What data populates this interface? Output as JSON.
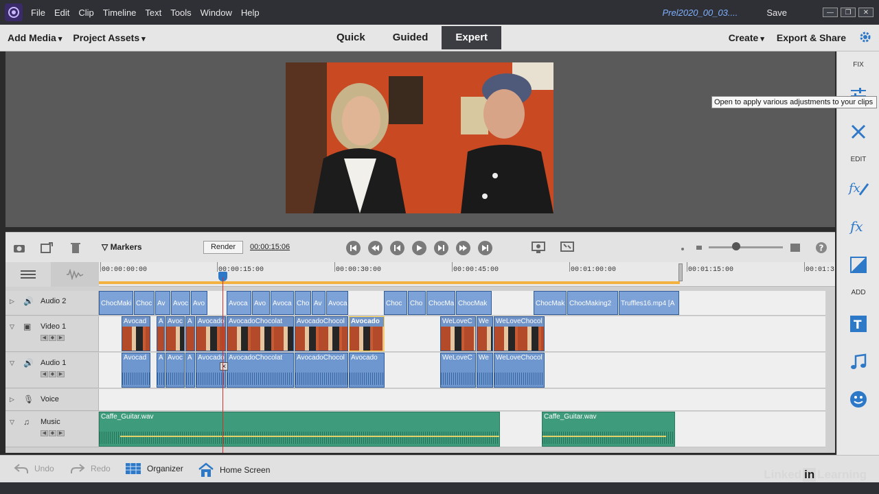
{
  "menu": {
    "items": [
      "File",
      "Edit",
      "Clip",
      "Timeline",
      "Text",
      "Tools",
      "Window",
      "Help"
    ],
    "doc_title": "Prel2020_00_03....",
    "save": "Save"
  },
  "topbar": {
    "add_media": "Add Media",
    "project_assets": "Project Assets",
    "modes": [
      "Quick",
      "Guided",
      "Expert"
    ],
    "active_mode": "Expert",
    "create": "Create",
    "export_share": "Export & Share"
  },
  "right_panel": {
    "fix_label": "FIX",
    "edit_label": "EDIT",
    "add_label": "ADD",
    "tooltip": "Open to apply various adjustments to your clips"
  },
  "timeline_controls": {
    "markers": "Markers",
    "render": "Render",
    "timecode": "00:00:15:06"
  },
  "ruler": {
    "ticks": [
      "00:00:00:00",
      "00:00:15:00",
      "00:00:30:00",
      "00:00:45:00",
      "00:01:00:00",
      "00:01:15:00",
      "00:01:3"
    ]
  },
  "tracks": {
    "audio2": "Audio 2",
    "video1": "Video 1",
    "audio1": "Audio 1",
    "voice": "Voice",
    "music": "Music"
  },
  "clips": {
    "audio2": [
      "ChocMaki",
      "Choc",
      "Av",
      "Avoc",
      "Avo",
      "Avoca",
      "Avo",
      "Avoca",
      "Cho",
      "Av",
      "Avoca",
      "Choc",
      "Cho",
      "ChocMa",
      "ChocMak",
      "ChocMak",
      "ChocMaking2",
      "Truffles16.mp4 [A"
    ],
    "video1": [
      "Avocad",
      "A",
      "Avoc",
      "A",
      "Avocado",
      "AvocadoChocolat",
      "AvocadoChocol",
      "Avocado",
      "WeLoveC",
      "We",
      "WeLoveChocol"
    ],
    "audio1": [
      "Avocad",
      "A",
      "Avoc",
      "A",
      "Avocado",
      "AvocadoChocolat",
      "AvocadoChocol",
      "Avocado",
      "WeLoveC",
      "We",
      "WeLoveChocol"
    ],
    "music": [
      "Caffe_Guitar.wav",
      "Caffe_Guitar.wav"
    ]
  },
  "bottombar": {
    "undo": "Undo",
    "redo": "Redo",
    "organizer": "Organizer",
    "home_screen": "Home Screen"
  },
  "watermark": "Linked in Learning",
  "colors": {
    "accent": "#2e78c8",
    "audio_clip": "#6f97cf",
    "music_clip": "#3e9c7c",
    "playhead": "#d13030"
  }
}
